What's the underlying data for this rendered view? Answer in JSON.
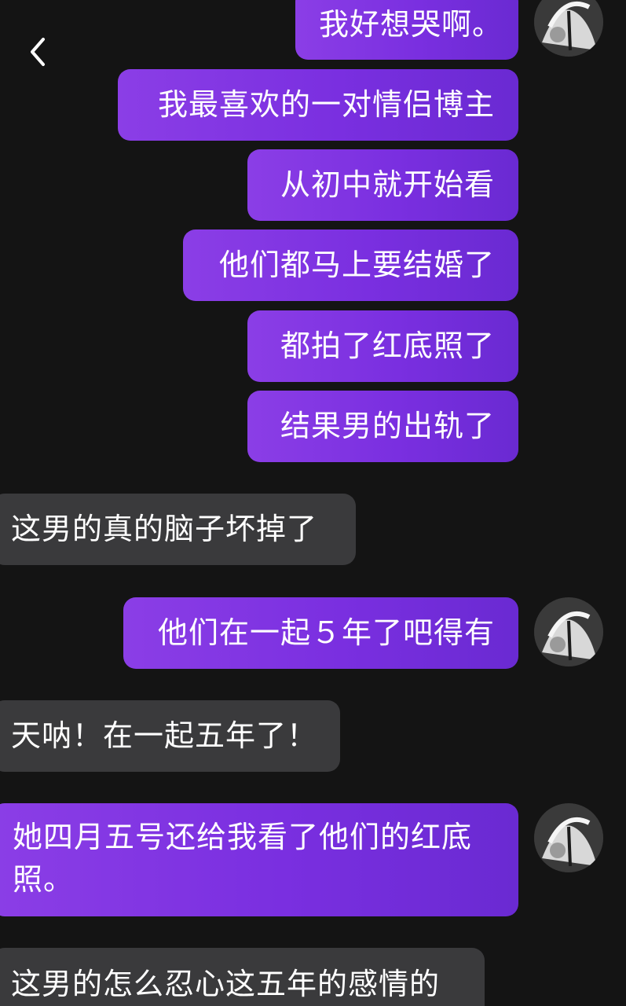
{
  "header": {
    "back_icon": "chevron-left-icon"
  },
  "colors": {
    "background": "#141414",
    "outgoing_bubble": "#7a2fe0",
    "incoming_bubble": "#3a3a3c",
    "text": "#ffffff"
  },
  "messages": [
    {
      "side": "out",
      "text": "我好想哭啊。"
    },
    {
      "side": "out",
      "text": "我最喜欢的一对情侣博主"
    },
    {
      "side": "out",
      "text": "从初中就开始看"
    },
    {
      "side": "out",
      "text": "他们都马上要结婚了"
    },
    {
      "side": "out",
      "text": "都拍了红底照了"
    },
    {
      "side": "out",
      "text": "结果男的出轨了"
    },
    {
      "side": "in",
      "text": "这男的真的脑子坏掉了"
    },
    {
      "side": "out",
      "text": "他们在一起５年了吧得有"
    },
    {
      "side": "in",
      "text": "天呐！在一起五年了！"
    },
    {
      "side": "out",
      "text": "她四月五号还给我看了他们的红底照。"
    },
    {
      "side": "in",
      "text": "这男的怎么忍心这五年的感情的"
    }
  ]
}
